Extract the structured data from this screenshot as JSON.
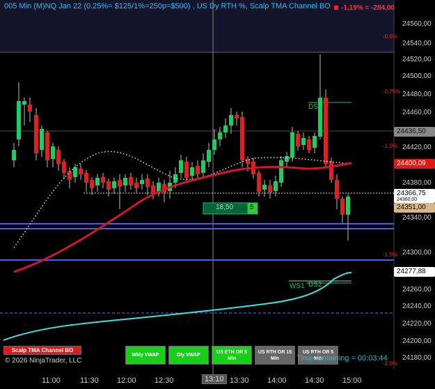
{
  "header": {
    "title": "005 Min (M)NQ Jan 22 (0.25%= $125/1%=250p=$500) , US Dy RTH %, Scalp TMA Channel BO",
    "pnl": "-1,19% = -284,00"
  },
  "price_axis": {
    "ticks": [
      "24560,00",
      "24540,00",
      "24520,00",
      "24500,00",
      "24480,00",
      "24460,00",
      "24420,00",
      "24380,00",
      "24340,00",
      "24300,00",
      "24260,00",
      "24240,00",
      "24220,00",
      "24200,00",
      "24180,00"
    ],
    "badges": {
      "grey": "24436,50",
      "red": "24400,09",
      "white": "24366,75",
      "white2": "24360,00",
      "tan": "24351,00",
      "white3": "24277,88"
    }
  },
  "pct_levels": [
    "-0.5%",
    "-0.75%",
    "-1.0%",
    "-1.5%",
    "-2.0%"
  ],
  "time_axis": [
    "11:00",
    "11:30",
    "12:00",
    "12:30",
    "13:10",
    "13:30",
    "14:00",
    "14:30",
    "15:00"
  ],
  "chart_labels": {
    "ds1": "DS1",
    "ws1": "WS1",
    "ds2": "DS2",
    "box_value": "18,50",
    "box_count": "5"
  },
  "buttons": {
    "scalp": "Scalp TMA Channel BO",
    "wkly": "Wkly VWAP",
    "dly": "Dly VWAP",
    "eth": "US ETH OR 5 Min",
    "rth15": "US RTH OR 15 Min",
    "rth5": "US RTH OR 5 Min"
  },
  "footer": {
    "copyright": "© 2026 NinjaTrader, LLC",
    "timer": "Time remaining = 00:03:44"
  },
  "colors": {
    "bull": "#18d060",
    "bear": "#e02020",
    "tma": "#d01828",
    "vwap": "#40e0e0",
    "orline": "#3060ff"
  }
}
